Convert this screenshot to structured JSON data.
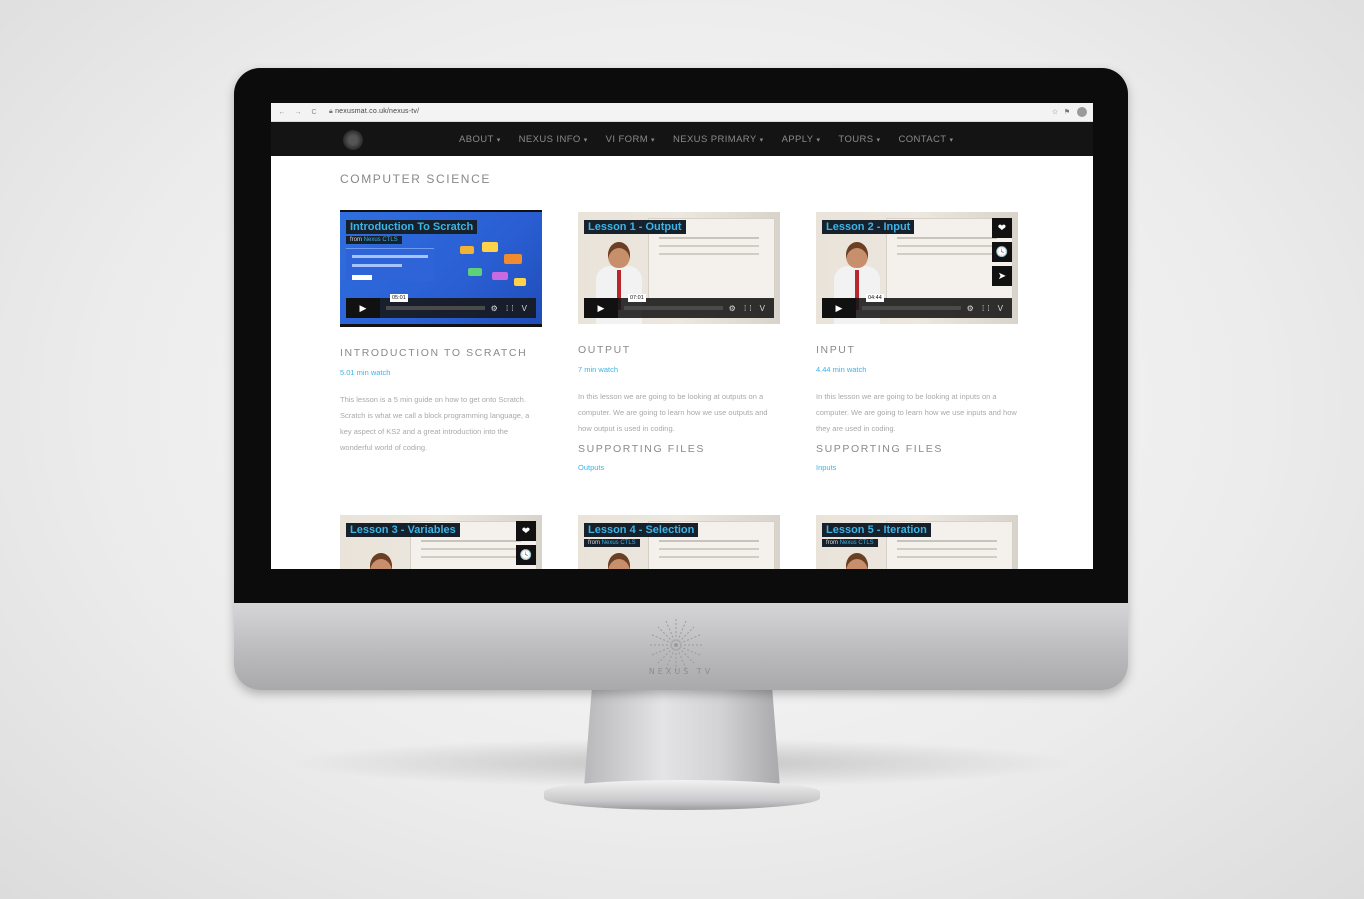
{
  "brand": {
    "chin_text": "NEXUS TV",
    "accent": "#3bb4e8"
  },
  "browser": {
    "url": "nexusmat.co.uk/nexus-tv/",
    "back": "←",
    "forward": "→",
    "reload": "C",
    "star_icon": "☆",
    "bookmark_icon": "⚑"
  },
  "nav": {
    "items": [
      "ABOUT",
      "NEXUS INFO",
      "VI FORM",
      "NEXUS PRIMARY",
      "APPLY",
      "TOURS",
      "CONTACT"
    ]
  },
  "page": {
    "title": "COMPUTER SCIENCE"
  },
  "cards": [
    {
      "video_title": "Introduction To Scratch",
      "from_label": "from",
      "from_name": "Nexus CTLS",
      "time": "05:01",
      "title": "INTRODUCTION TO SCRATCH",
      "duration": "5.01 min watch",
      "description": "This lesson is a 5 min guide on how to get onto Scratch. Scratch is what we call a block programming language, a key aspect of KS2 and a great introduction into the wonderful world of coding."
    },
    {
      "video_title": "Lesson 1 - Output",
      "time": "07:01",
      "title": "OUTPUT",
      "duration": "7 min watch",
      "description": "In this lesson we are going to be looking at outputs on a computer. We are going to learn how we use outputs and how output is used in coding.",
      "files_title": "SUPPORTING FILES",
      "files_link": "Outputs"
    },
    {
      "video_title": "Lesson 2 - Input",
      "time": "04:44",
      "title": "INPUT",
      "duration": "4.44 min watch",
      "description": "In this lesson we are going to be looking at inputs on a computer. We are going to learn how we use inputs and how they are used in coding.",
      "files_title": "SUPPORTING FILES",
      "files_link": "Inputs"
    },
    {
      "video_title": "Lesson 3 - Variables"
    },
    {
      "video_title": "Lesson 4 - Selection",
      "from_label": "from",
      "from_name": "Nexus CTLS"
    },
    {
      "video_title": "Lesson 5 - Iteration",
      "from_label": "from",
      "from_name": "Nexus CTLS"
    }
  ],
  "player": {
    "play_icon": "▶",
    "controls_icons": "⚙ ⁞⁞ V",
    "heart_icon": "❤",
    "clock_icon": "🕓",
    "send_icon": "➤"
  }
}
